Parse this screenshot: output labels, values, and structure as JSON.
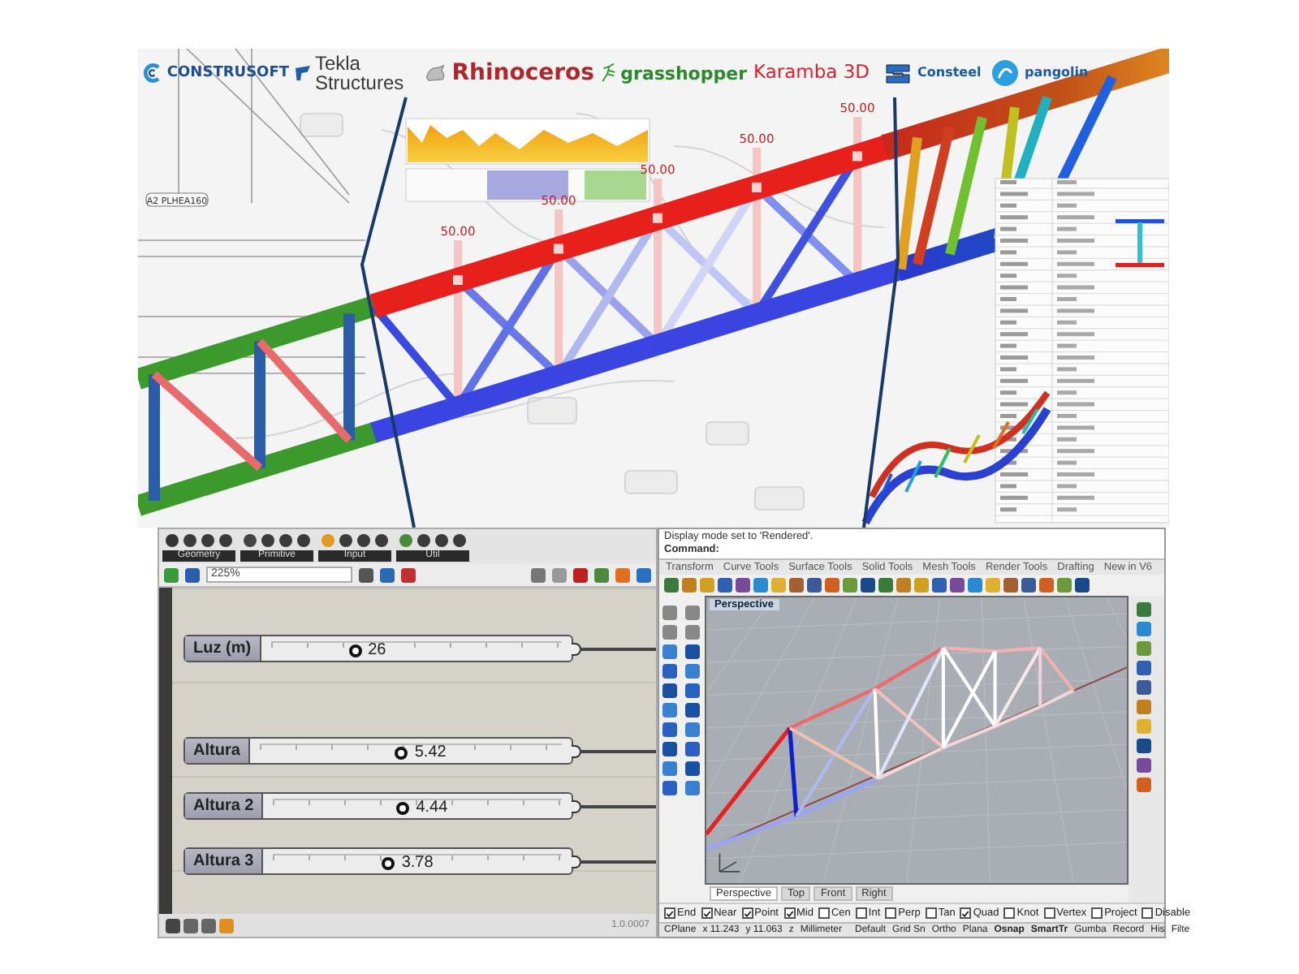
{
  "banner": {
    "logos": [
      {
        "kind": "construsoft",
        "text": "CONSTRUSOFT"
      },
      {
        "kind": "tekla",
        "text": "Tekla Structures"
      },
      {
        "kind": "rhino",
        "text": "Rhinoceros"
      },
      {
        "kind": "grasshopper",
        "text": "grasshopper"
      },
      {
        "kind": "karamba",
        "text": "Karamba 3D"
      },
      {
        "kind": "consteel",
        "text": "Consteel"
      },
      {
        "kind": "pangolin",
        "text": "pangolin"
      }
    ],
    "section_label": "A2 PLHEA160",
    "load_labels": [
      "50.00",
      "50.00",
      "50.00",
      "50.00",
      "50.00"
    ]
  },
  "grasshopper": {
    "toolbar_groups": [
      "Geometry",
      "Primitive",
      "Input",
      "Util"
    ],
    "zoom": "225%",
    "sliders": [
      {
        "label": "Luz (m)",
        "value": "26",
        "level": 0.29
      },
      {
        "label": "Altura",
        "value": "5.42",
        "level": 0.47
      },
      {
        "label": "Altura 2",
        "value": "4.44",
        "level": 0.45
      },
      {
        "label": "Altura 3",
        "value": "3.78",
        "level": 0.4
      }
    ],
    "version": "1.0.0007"
  },
  "rhino": {
    "command_history": "Display mode set to 'Rendered'.",
    "command_prompt": "Command:",
    "tabs": [
      "Transform",
      "Curve Tools",
      "Surface Tools",
      "Solid Tools",
      "Mesh Tools",
      "Render Tools",
      "Drafting",
      "New in V6"
    ],
    "viewport": {
      "title": "Perspective"
    },
    "viewport_tabs": [
      {
        "label": "Perspective",
        "selected": true
      },
      {
        "label": "Top",
        "selected": false
      },
      {
        "label": "Front",
        "selected": false
      },
      {
        "label": "Right",
        "selected": false
      }
    ],
    "osnaps": [
      {
        "label": "End",
        "checked": true
      },
      {
        "label": "Near",
        "checked": true
      },
      {
        "label": "Point",
        "checked": true
      },
      {
        "label": "Mid",
        "checked": true
      },
      {
        "label": "Cen",
        "checked": false
      },
      {
        "label": "Int",
        "checked": false
      },
      {
        "label": "Perp",
        "checked": false
      },
      {
        "label": "Tan",
        "checked": false
      },
      {
        "label": "Quad",
        "checked": true
      },
      {
        "label": "Knot",
        "checked": false
      },
      {
        "label": "Vertex",
        "checked": false
      },
      {
        "label": "Project",
        "checked": false
      },
      {
        "label": "Disable",
        "checked": false
      }
    ],
    "status": {
      "cplane": "CPlane",
      "x": "x 11.243",
      "y": "y 11.063",
      "z": "z",
      "units": "Millimeter",
      "layer": "Default",
      "panes": [
        {
          "label": "Grid Sn",
          "on": false
        },
        {
          "label": "Ortho",
          "on": false
        },
        {
          "label": "Plana",
          "on": false
        },
        {
          "label": "Osnap",
          "on": true
        },
        {
          "label": "SmartTr",
          "on": true
        },
        {
          "label": "Gumba",
          "on": false
        },
        {
          "label": "Record",
          "on": false
        },
        {
          "label": "His",
          "on": false
        },
        {
          "label": "Filte",
          "on": false
        }
      ]
    }
  }
}
